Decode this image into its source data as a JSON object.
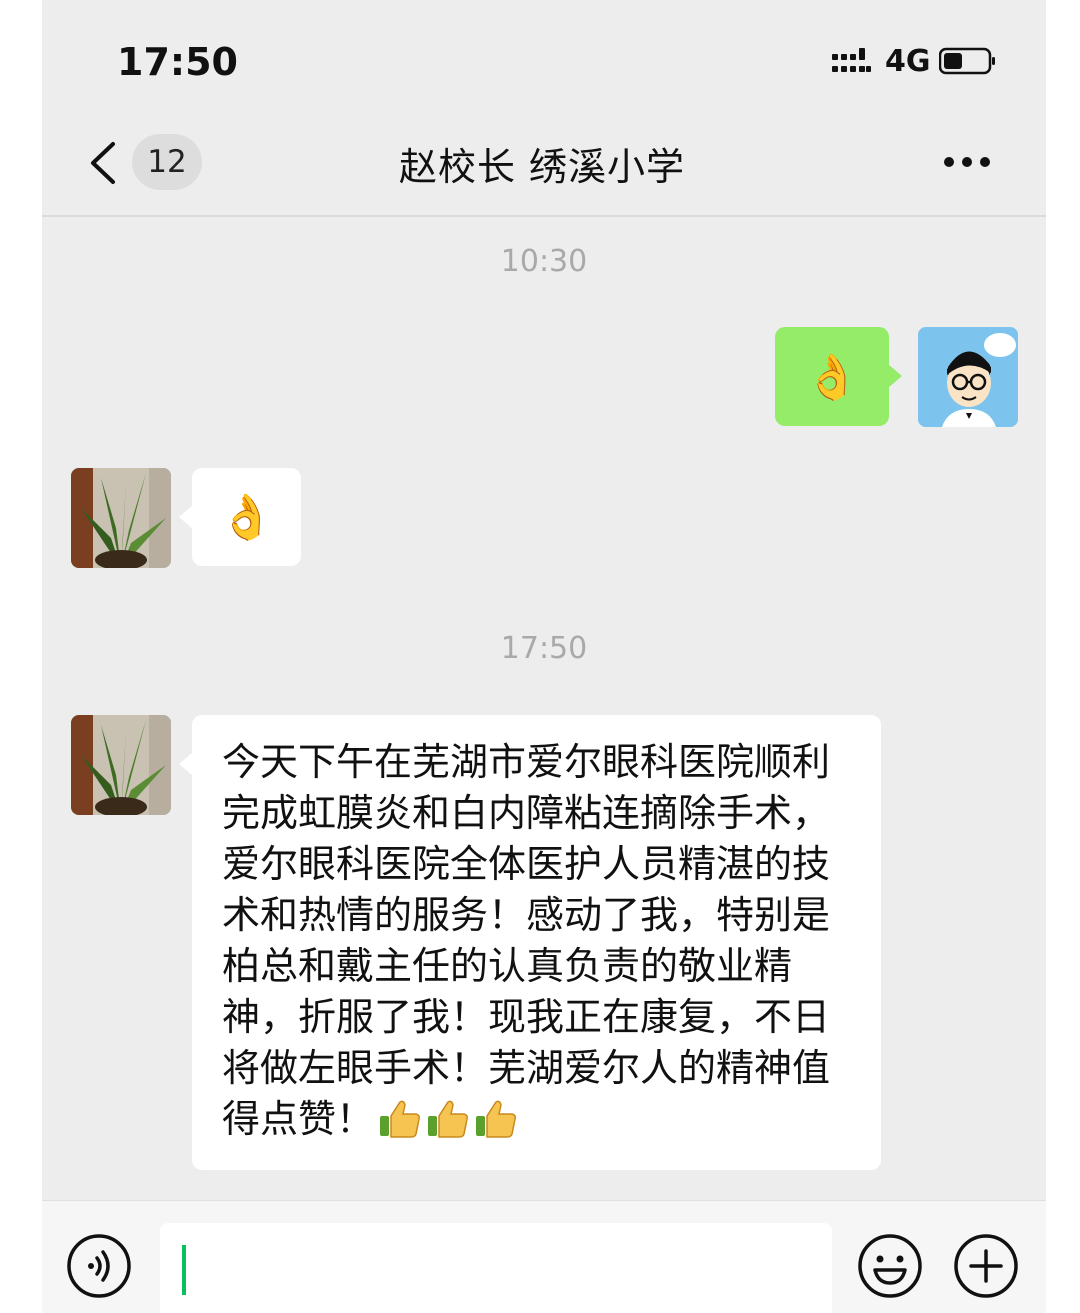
{
  "status_bar": {
    "time": "17:50",
    "network": "4G"
  },
  "header": {
    "unread_count": "12",
    "title": "赵校长  绣溪小学"
  },
  "timestamps": [
    "10:30",
    "17:50"
  ],
  "messages": [
    {
      "direction": "outgoing",
      "kind": "emoji",
      "content": "👌"
    },
    {
      "direction": "incoming",
      "kind": "emoji",
      "content": "👌"
    },
    {
      "direction": "incoming",
      "kind": "text",
      "text": "今天下午在芜湖市爱尔眼科医院顺利完成虹膜炎和白内障粘连摘除手术，爱尔眼科医院全体医护人员精湛的技术和热情的服务！感动了我，特别是柏总和戴主任的认真负责的敬业精神，折服了我！现我正在康复，不日将做左眼手术！芜湖爱尔人的精神值得点赞！",
      "trailing_emoji": [
        "thumbs-up",
        "thumbs-up",
        "thumbs-up"
      ]
    }
  ],
  "colors": {
    "outgoing_bubble": "#95ec69",
    "incoming_bubble": "#ffffff",
    "background": "#ededed",
    "caret": "#07c160"
  }
}
